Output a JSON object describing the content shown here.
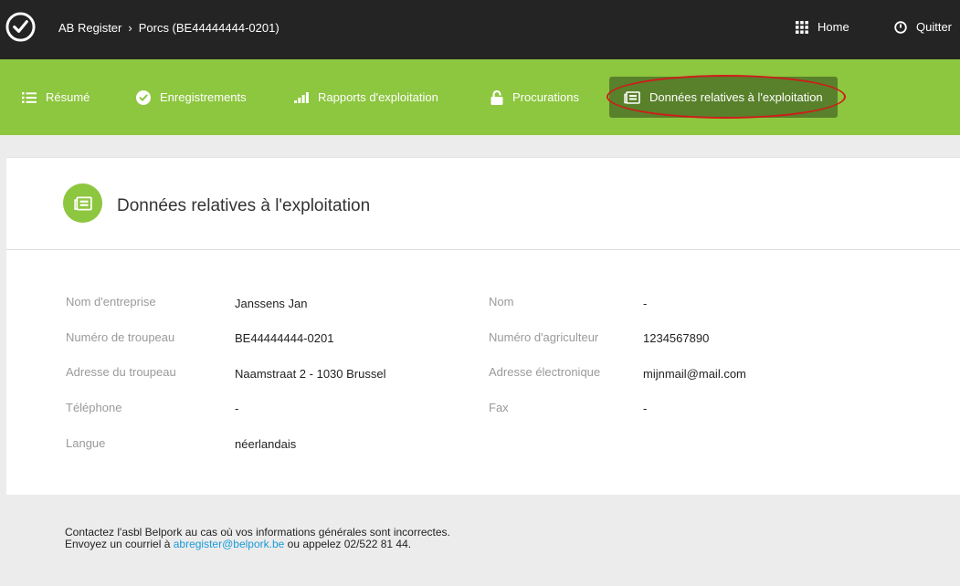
{
  "topbar": {
    "breadcrumb_root": "AB Register",
    "breadcrumb_current": "Porcs (BE44444444-0201)",
    "home_label": "Home",
    "quit_label": "Quitter"
  },
  "nav": {
    "items": [
      {
        "label": "Résumé",
        "icon": "list-icon"
      },
      {
        "label": "Enregistrements",
        "icon": "check-circle-icon"
      },
      {
        "label": "Rapports d'exploitation",
        "icon": "signal-bars-icon"
      },
      {
        "label": "Procurations",
        "icon": "lock-icon"
      },
      {
        "label": "Données relatives à l'exploitation",
        "icon": "id-card-icon",
        "active": true
      }
    ]
  },
  "page": {
    "title": "Données relatives à l'exploitation"
  },
  "fields": {
    "company_name": {
      "label": "Nom d'entreprise",
      "value": "Janssens Jan"
    },
    "herd_number": {
      "label": "Numéro de troupeau",
      "value": "BE44444444-0201"
    },
    "herd_address": {
      "label": "Adresse du troupeau",
      "value": "Naamstraat 2 - 1030 Brussel"
    },
    "phone": {
      "label": "Téléphone",
      "value": "-"
    },
    "language": {
      "label": "Langue",
      "value": "néerlandais"
    },
    "name": {
      "label": "Nom",
      "value": "-"
    },
    "farmer_number": {
      "label": "Numéro d'agriculteur",
      "value": "1234567890"
    },
    "email": {
      "label": "Adresse électronique",
      "value": "mijnmail@mail.com"
    },
    "fax": {
      "label": "Fax",
      "value": "-"
    }
  },
  "footer": {
    "line1": "Contactez l'asbl Belpork au cas où vos informations générales sont incorrectes.",
    "line2_prefix": "Envoyez un courriel à ",
    "email_link": "abregister@belpork.be",
    "line2_suffix": " ou appelez 02/522 81 44."
  },
  "colors": {
    "topbar": "#242424",
    "nav": "#8dc63f",
    "nav_active": "#59802a",
    "link": "#1a9bd7"
  }
}
